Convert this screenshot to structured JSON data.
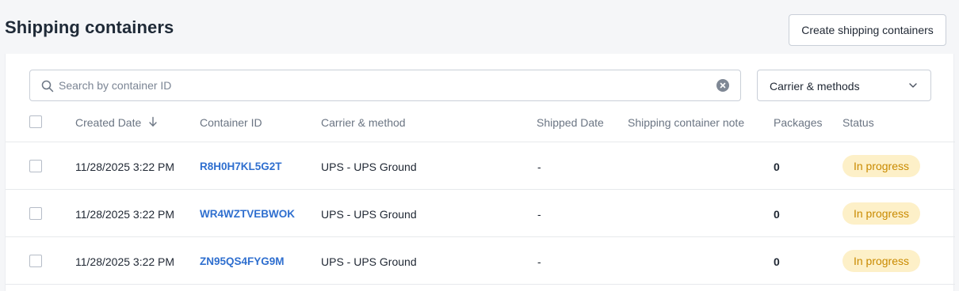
{
  "header": {
    "title": "Shipping containers",
    "create_button": "Create shipping containers"
  },
  "filters": {
    "search_placeholder": "Search by container ID",
    "search_value": "",
    "carrier_select_label": "Carrier & methods"
  },
  "table": {
    "columns": {
      "created_date": "Created Date",
      "container_id": "Container ID",
      "carrier_method": "Carrier & method",
      "shipped_date": "Shipped Date",
      "note": "Shipping container note",
      "packages": "Packages",
      "status": "Status"
    },
    "sort": {
      "column": "Created Date",
      "direction": "descending"
    },
    "rows": [
      {
        "created": "11/28/2025 3:22 PM",
        "id": "R8H0H7KL5G2T",
        "carrier": "UPS - UPS Ground",
        "shipped": "-",
        "note": "",
        "packages": "0",
        "status": "In progress"
      },
      {
        "created": "11/28/2025 3:22 PM",
        "id": "WR4WZTVEBWOK",
        "carrier": "UPS - UPS Ground",
        "shipped": "-",
        "note": "",
        "packages": "0",
        "status": "In progress"
      },
      {
        "created": "11/28/2025 3:22 PM",
        "id": "ZN95QS4FYG9M",
        "carrier": "UPS - UPS Ground",
        "shipped": "-",
        "note": "",
        "packages": "0",
        "status": "In progress"
      }
    ]
  },
  "colors": {
    "link": "#2f6fcf",
    "badge_bg": "#fdf0c8",
    "badge_text": "#c98a00"
  },
  "icons": [
    "search-icon",
    "clear-icon",
    "chevron-down-icon",
    "arrow-down-icon"
  ]
}
